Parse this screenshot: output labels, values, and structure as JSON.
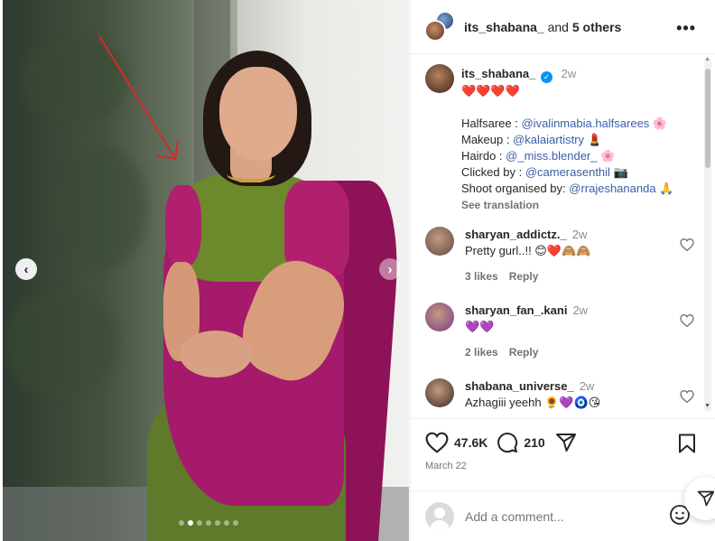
{
  "header": {
    "username": "its_shabana_",
    "and_text": " and ",
    "others": "5 others",
    "more_icon": "more-horizontal-icon"
  },
  "media": {
    "carousel_dots": 7,
    "active_dot": 1
  },
  "caption": {
    "username": "its_shabana_",
    "time": "2w",
    "emoji_line": "❤️❤️❤️❤️",
    "credits": [
      {
        "label": "Halfsaree : ",
        "mention": "@ivalinmabia.halfsarees",
        "suffix": " 🌸"
      },
      {
        "label": "Makeup : ",
        "mention": "@kalaiartistry",
        "suffix": " 💄"
      },
      {
        "label": "Hairdo : ",
        "mention": "@_miss.blender_",
        "suffix": " 🌸"
      },
      {
        "label": "Clicked by : ",
        "mention": "@camerasenthil",
        "suffix": " 📷"
      },
      {
        "label": "Shoot organised by: ",
        "mention": "@rrajeshananda",
        "suffix": " 🙏"
      }
    ],
    "see_translation": "See translation"
  },
  "comments": [
    {
      "username": "sharyan_addictz._",
      "time": "2w",
      "text": "Pretty gurl..!! 😊❤️🙈🙈",
      "likes": "3 likes",
      "reply": "Reply",
      "avatar_color": "#5b4b45"
    },
    {
      "username": "sharyan_fan_.kani",
      "time": "2w",
      "text": "💜💜",
      "likes": "2 likes",
      "reply": "Reply",
      "avatar_color": "#7b3a8a"
    },
    {
      "username": "shabana_universe_",
      "time": "2w",
      "text": "Azhagiii yeehh 🌻💜🧿😘",
      "likes": "",
      "reply": "",
      "avatar_color": "#3a2a26"
    }
  ],
  "actions": {
    "likes_count": "47.6K",
    "comments_count": "210",
    "date": "March 22"
  },
  "add_comment": {
    "placeholder": "Add a comment..."
  },
  "colors": {
    "accent_blue": "#0095f6",
    "mention": "#3b5ea8",
    "muted": "#737373"
  }
}
